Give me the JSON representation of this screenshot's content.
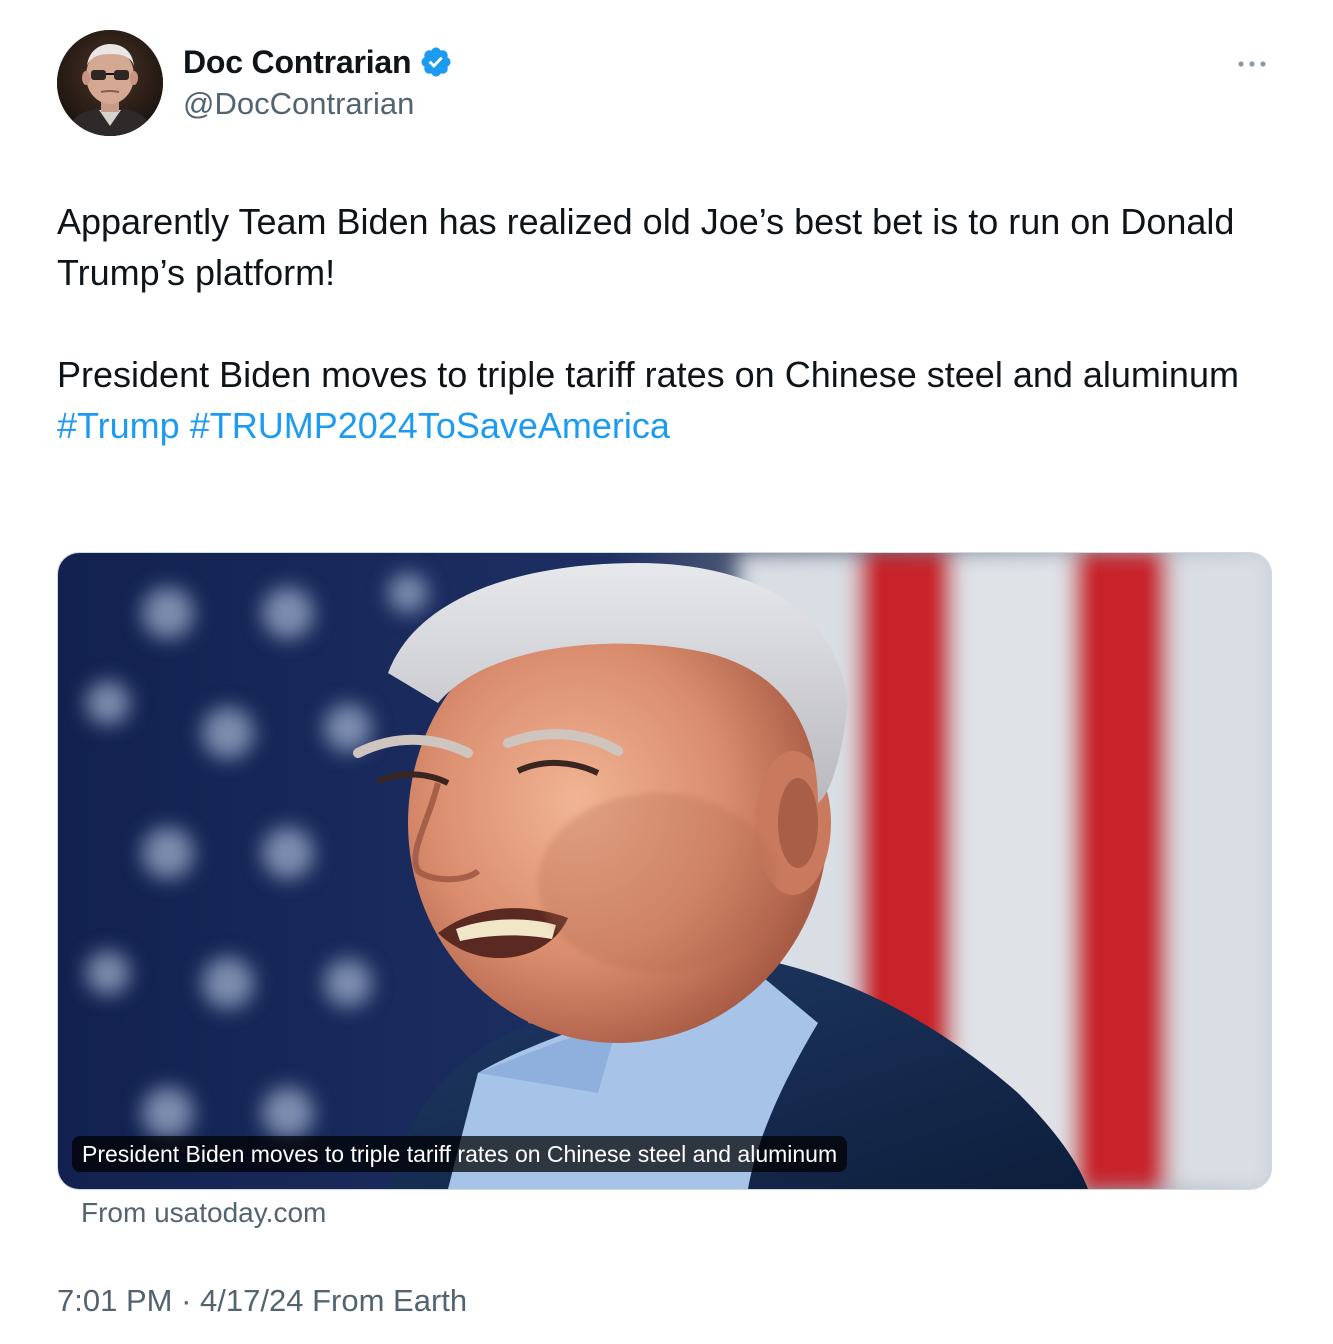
{
  "author": {
    "display_name": "Doc Contrarian",
    "handle": "@DocContrarian",
    "verified": true
  },
  "icons": {
    "verified": "verified-badge-icon",
    "more": "more-options-icon"
  },
  "tweet": {
    "paragraph1": "Apparently Team Biden has realized old Joe’s best bet is to run on Donald Trump’s platform!",
    "paragraph2": "President Biden moves to triple tariff rates on Chinese steel and aluminum",
    "hashtags": [
      "#Trump",
      "#TRUMP2024ToSaveAmerica"
    ]
  },
  "card": {
    "caption": "President Biden moves to triple tariff rates on Chinese steel and aluminum",
    "source": "From usatoday.com"
  },
  "meta": {
    "time": "7:01 PM",
    "separator": "·",
    "date": "4/17/24",
    "location": "From Earth"
  },
  "colors": {
    "link": "#1d9bf0",
    "secondary_text": "#536471",
    "primary_text": "#0f1419",
    "verified": "#1d9bf0"
  }
}
